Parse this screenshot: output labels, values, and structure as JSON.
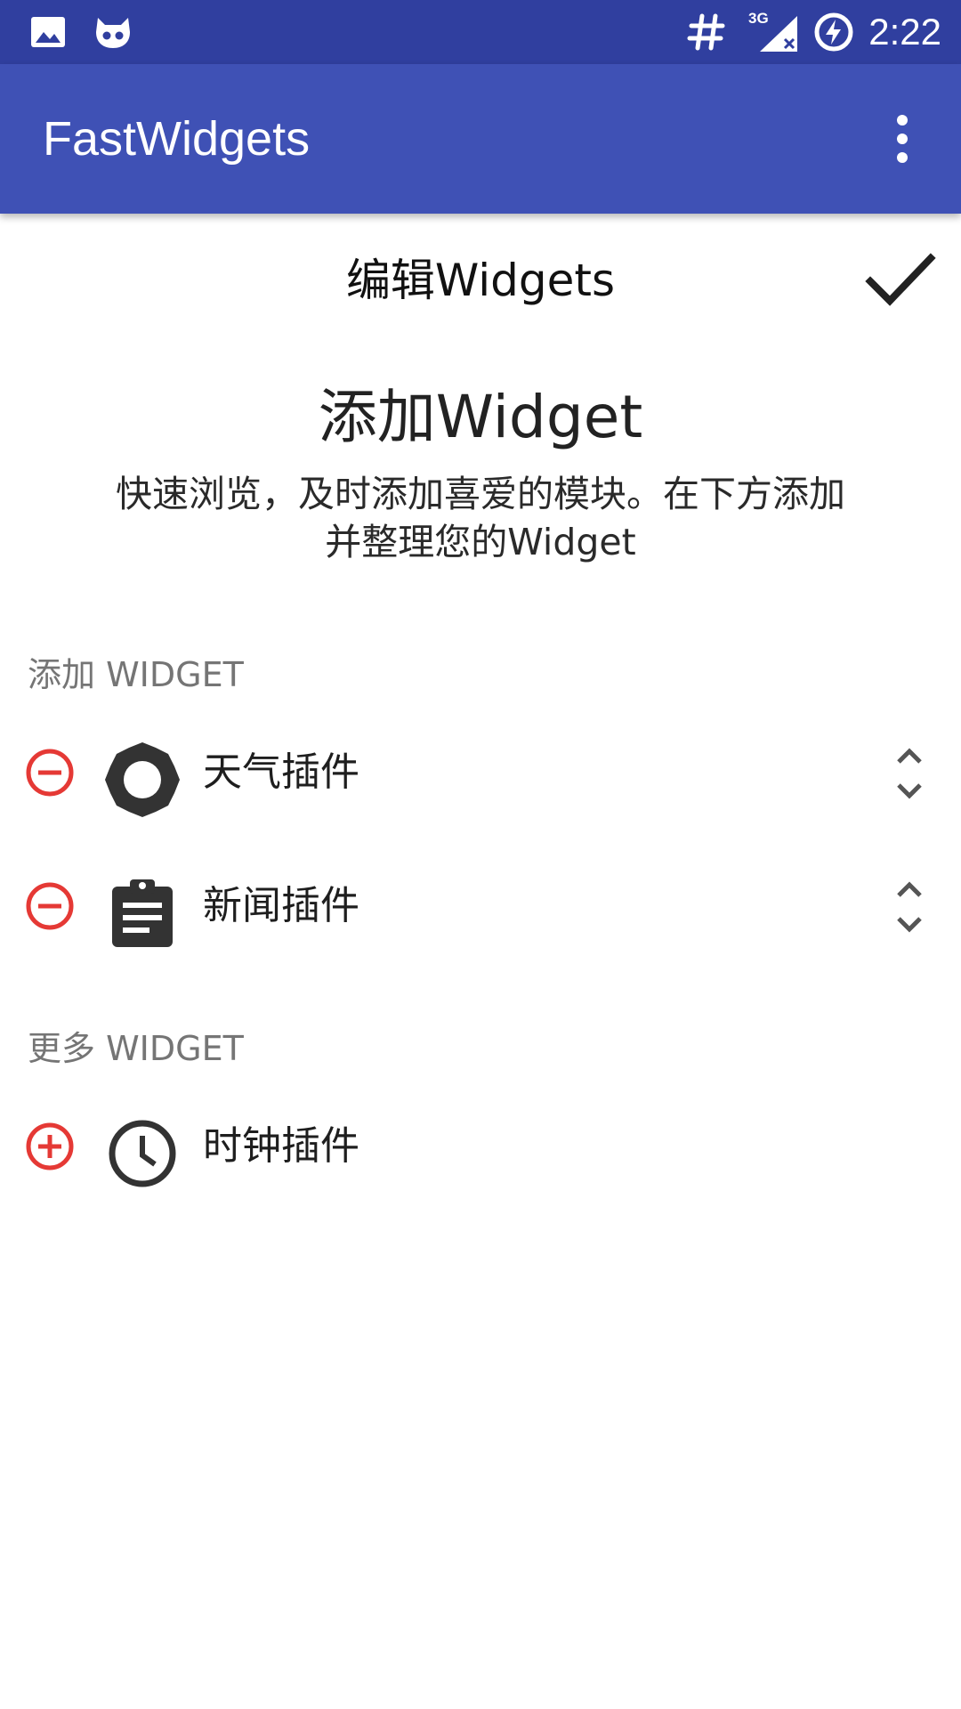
{
  "status_bar": {
    "time": "2:22",
    "network_type": "3G",
    "icons": [
      "image-icon",
      "cyanogen-icon",
      "hash-icon",
      "signal-icon",
      "battery-charging-icon"
    ]
  },
  "app_bar": {
    "title": "FastWidgets",
    "overflow_icon": "more-vert-icon"
  },
  "editor": {
    "title": "编辑Widgets",
    "confirm_icon": "check-icon"
  },
  "intro": {
    "title": "添加Widget",
    "description": "快速浏览，及时添加喜爱的模块。在下方添加并整理您的Widget"
  },
  "added_section": {
    "label": "添加 WIDGET",
    "items": [
      {
        "label": "天气插件",
        "icon": "brightness-icon",
        "action_icon": "remove-circle-icon",
        "reorder_icon": "unfold-more-icon"
      },
      {
        "label": "新闻插件",
        "icon": "clipboard-icon",
        "action_icon": "remove-circle-icon",
        "reorder_icon": "unfold-more-icon"
      }
    ]
  },
  "more_section": {
    "label": "更多 WIDGET",
    "items": [
      {
        "label": "时钟插件",
        "icon": "clock-icon",
        "action_icon": "add-circle-icon"
      }
    ]
  },
  "colors": {
    "status_bar": "#303F9F",
    "app_bar": "#3F51B5",
    "action_red": "#E53935",
    "icon_dark": "#333333",
    "section_label": "#757575"
  }
}
